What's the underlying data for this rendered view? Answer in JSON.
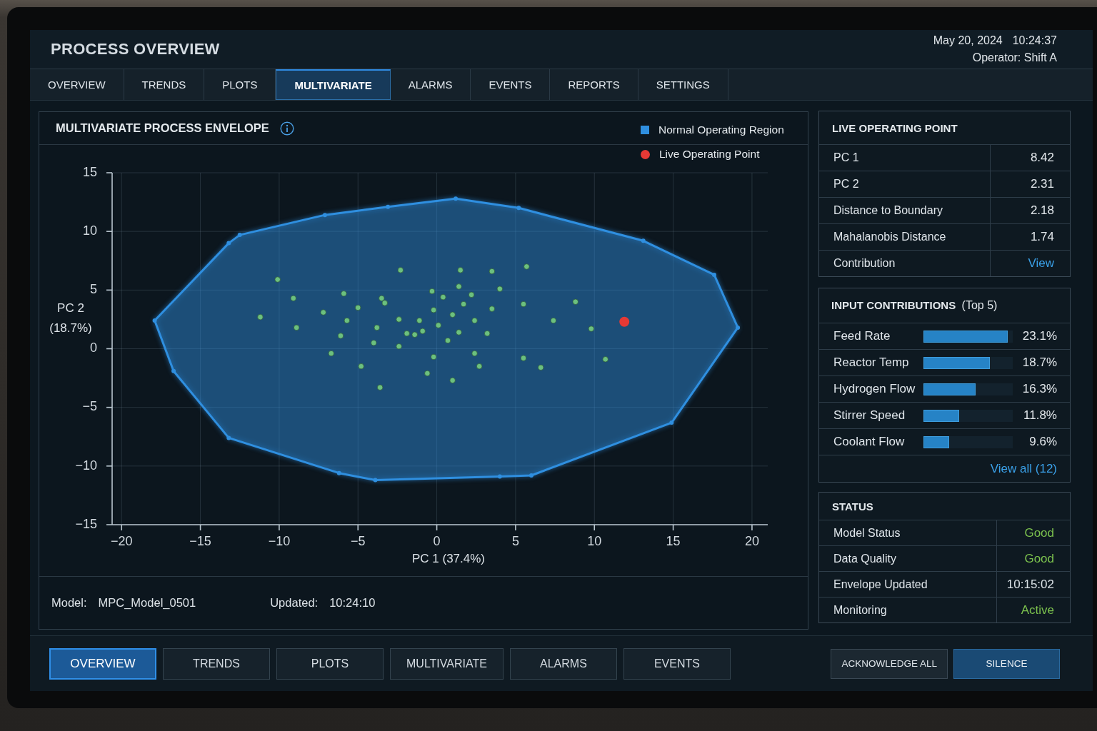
{
  "header": {
    "title": "PROCESS OVERVIEW",
    "date": "May 20, 2024",
    "time": "10:24:37",
    "operator": "Operator: Shift A"
  },
  "tabs": [
    {
      "label": "OVERVIEW",
      "selected": false
    },
    {
      "label": "TRENDS",
      "selected": false
    },
    {
      "label": "PLOTS",
      "selected": false
    },
    {
      "label": "MULTIVARIATE",
      "selected": true
    },
    {
      "label": "ALARMS",
      "selected": false
    },
    {
      "label": "EVENTS",
      "selected": false
    },
    {
      "label": "REPORTS",
      "selected": false
    },
    {
      "label": "SETTINGS",
      "selected": false
    }
  ],
  "plot": {
    "title": "MULTIVARIATE PROCESS ENVELOPE",
    "chart_data": {
      "type": "scatter",
      "xlabel": "PC 1 (37.4%)",
      "ylabel": "PC 2 (18.7%)",
      "grid": true,
      "xlim": [
        -20.6,
        21
      ],
      "ylim": [
        -15,
        15
      ],
      "xticks": [
        {
          "value": -20,
          "label": "−20"
        },
        {
          "value": -15,
          "label": "−15"
        },
        {
          "value": -10,
          "label": "−10"
        },
        {
          "value": -5,
          "label": "−5"
        },
        0,
        5,
        10,
        15,
        20
      ],
      "yticks": [
        {
          "value": -15,
          "label": "−15"
        },
        {
          "value": -10,
          "label": "−10"
        },
        {
          "value": -5,
          "label": "−5"
        },
        0,
        5,
        10,
        15
      ],
      "series": [
        {
          "name": "Normal Operating Region",
          "type": "area",
          "color": "#2f8fe0",
          "x": [
            -17.9,
            -13.2,
            -12.5,
            -7.1,
            -3.1,
            1.2,
            5.2,
            13.1,
            17.6,
            19.1,
            14.9,
            6.0,
            4.0,
            -3.9,
            -6.2,
            -13.2,
            -16.7
          ],
          "values": [
            2.4,
            9.0,
            9.7,
            11.4,
            12.1,
            12.8,
            12.0,
            9.2,
            6.3,
            1.8,
            -6.3,
            -10.8,
            -10.9,
            -11.2,
            -10.6,
            -7.6,
            -1.9
          ]
        },
        {
          "type": "scatter",
          "color": "#6cc07f",
          "x": [
            -10.1,
            -11.2,
            -9.1,
            -8.9,
            -7.2,
            -5.9,
            -5.7,
            -5.0,
            -6.1,
            -6.7,
            -4.8,
            -3.6,
            -3.8,
            -4.0,
            -3.5,
            -3.3,
            -2.4,
            -2.3,
            -1.9,
            -1.4,
            -1.1,
            -0.9,
            -2.4,
            -0.6,
            -0.3,
            -0.2,
            -0.2,
            0.1,
            0.4,
            0.7,
            1.0,
            1.0,
            1.4,
            1.4,
            1.5,
            1.7,
            2.2,
            2.4,
            2.4,
            2.7,
            3.2,
            3.5,
            3.5,
            4.0,
            5.5,
            5.5,
            5.7,
            6.6,
            7.4,
            8.8,
            9.8,
            10.7
          ],
          "values": [
            5.9,
            2.7,
            4.3,
            1.8,
            3.1,
            4.7,
            2.4,
            3.5,
            1.1,
            -0.4,
            -1.5,
            -3.3,
            1.8,
            0.5,
            4.3,
            3.9,
            2.5,
            6.7,
            1.3,
            1.2,
            2.4,
            1.5,
            0.2,
            -2.1,
            4.9,
            3.3,
            -0.7,
            2.0,
            4.4,
            0.7,
            -2.7,
            2.9,
            5.3,
            1.4,
            6.7,
            3.8,
            4.6,
            2.4,
            -0.4,
            -1.5,
            1.3,
            3.4,
            6.6,
            5.1,
            3.8,
            -0.8,
            7.0,
            -1.6,
            2.4,
            4.0,
            1.7,
            -0.9
          ]
        },
        {
          "name": "Live Operating Point",
          "type": "scatter",
          "color": "#e53935",
          "x": [
            11.9
          ],
          "values": [
            2.3
          ]
        }
      ]
    },
    "footer": [
      {
        "label": "Model:",
        "value": "MPC_Model_0501"
      },
      {
        "label": "Updated:",
        "value": "10:24:10"
      }
    ]
  },
  "live_operating_point": {
    "title": "LIVE OPERATING POINT",
    "rows": [
      {
        "label": "PC 1",
        "value": "8.42",
        "kind": "value"
      },
      {
        "label": "PC 2",
        "value": "2.31",
        "kind": "value"
      },
      {
        "label": "Distance to Boundary",
        "value": "2.18",
        "kind": "value"
      },
      {
        "label": "Mahalanobis Distance",
        "value": "1.74",
        "kind": "value"
      },
      {
        "label": "Contribution",
        "value": "View",
        "kind": "link"
      }
    ]
  },
  "input_contributions": {
    "title": "**INPUT CONTRIBUTIONS** (Top 5)",
    "rows": [
      {
        "label": "Feed Rate",
        "level": 0.94,
        "value": "23.1%"
      },
      {
        "label": "Reactor Temp",
        "level": 0.74,
        "value": "18.7%"
      },
      {
        "label": "Hydrogen Flow",
        "level": 0.58,
        "value": "16.3%"
      },
      {
        "label": "Stirrer Speed",
        "level": 0.4,
        "value": "11.8%"
      },
      {
        "label": "Coolant Flow",
        "level": 0.29,
        "value": "9.6%"
      }
    ],
    "link": "View all (12)"
  },
  "status": {
    "title": "STATUS",
    "rows": [
      {
        "label": "Model Status",
        "value": "Good",
        "color": "#7cc24e"
      },
      {
        "label": "Data Quality",
        "value": "Good",
        "color": "#7cc24e"
      },
      {
        "label": "Envelope Updated",
        "value": "10:15:02",
        "color": "#dbe2e7"
      },
      {
        "label": "Monitoring",
        "value": "Active",
        "color": "#7cc24e"
      }
    ]
  },
  "bottom_nav": [
    {
      "label": "OVERVIEW",
      "selected": true
    },
    {
      "label": "TRENDS",
      "selected": false
    },
    {
      "label": "PLOTS",
      "selected": false
    },
    {
      "label": "MULTIVARIATE",
      "selected": false
    },
    {
      "label": "ALARMS",
      "selected": false
    },
    {
      "label": "EVENTS",
      "selected": false
    }
  ],
  "actions": [
    {
      "label": "ACKNOWLEDGE ALL",
      "kind": "secondary"
    },
    {
      "label": "SILENCE",
      "kind": "primary"
    }
  ]
}
